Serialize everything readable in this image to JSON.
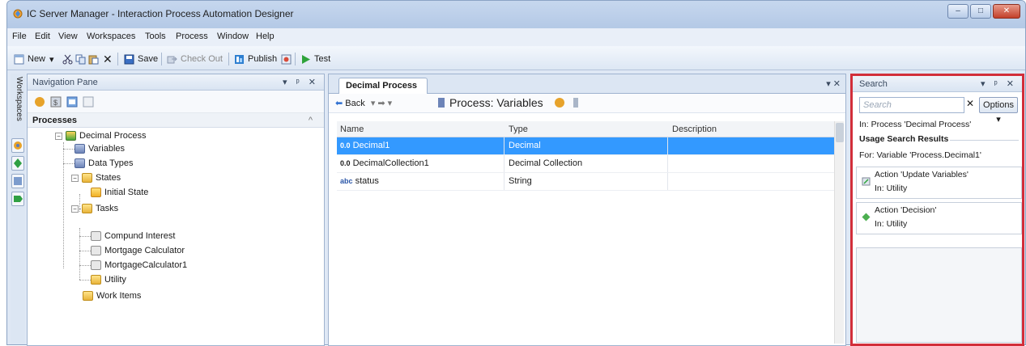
{
  "window": {
    "title": "IC Server Manager - Interaction Process Automation Designer",
    "controls": [
      "–",
      "□",
      "✕"
    ]
  },
  "menu": [
    "File",
    "Edit",
    "View",
    "Workspaces",
    "Tools",
    "Process",
    "Window",
    "Help"
  ],
  "toolbar": {
    "new_label": "New",
    "save_label": "Save",
    "checkout_label": "Check Out",
    "publish_label": "Publish",
    "test_label": "Test"
  },
  "workspaces": {
    "label": "Workspaces"
  },
  "nav_pane": {
    "title": "Navigation Pane",
    "buttons": "▾ ᵖ ✕",
    "section": "Processes",
    "section_caret": "^",
    "tree": {
      "root": "Decimal Process",
      "variables": "Variables",
      "data_types": "Data Types",
      "states": "States",
      "initial_state": "Initial State",
      "tasks": "Tasks",
      "task_items": [
        "Compund Interest",
        "Mortgage Calculator",
        "MortgageCalculator1",
        "Utility"
      ],
      "work_items": "Work Items"
    }
  },
  "document": {
    "tab_label": "Decimal Process",
    "tab_controls": "▾ ✕",
    "back_label": "Back",
    "nav_arrows": "▾ ➡ ▾",
    "page_title": "Process: Variables",
    "columns": [
      "Name",
      "Type",
      "Description"
    ],
    "rows": [
      {
        "icon": "0.0",
        "name": "Decimal1",
        "type": "Decimal",
        "description": ""
      },
      {
        "icon": "0.0",
        "name": "DecimalCollection1",
        "type": "Decimal Collection",
        "description": ""
      },
      {
        "icon": "abc",
        "name": "status",
        "type": "String",
        "description": ""
      }
    ]
  },
  "search_pane": {
    "title": "Search",
    "buttons": "▾ ᵖ ✕",
    "placeholder": "Search",
    "clear": "✕",
    "options_label": "Options ▾",
    "scope": "In: Process 'Decimal Process'",
    "results_header": "Usage Search Results",
    "for_text": "For: Variable 'Process.Decimal1'",
    "results": [
      {
        "title": "Action 'Update Variables'",
        "location": "In: Utility"
      },
      {
        "title": "Action 'Decision'",
        "location": "In: Utility"
      }
    ]
  },
  "colors": {
    "selection": "#3399ff",
    "highlight_border": "#d22e3a",
    "chrome": "#dfe8f5"
  }
}
